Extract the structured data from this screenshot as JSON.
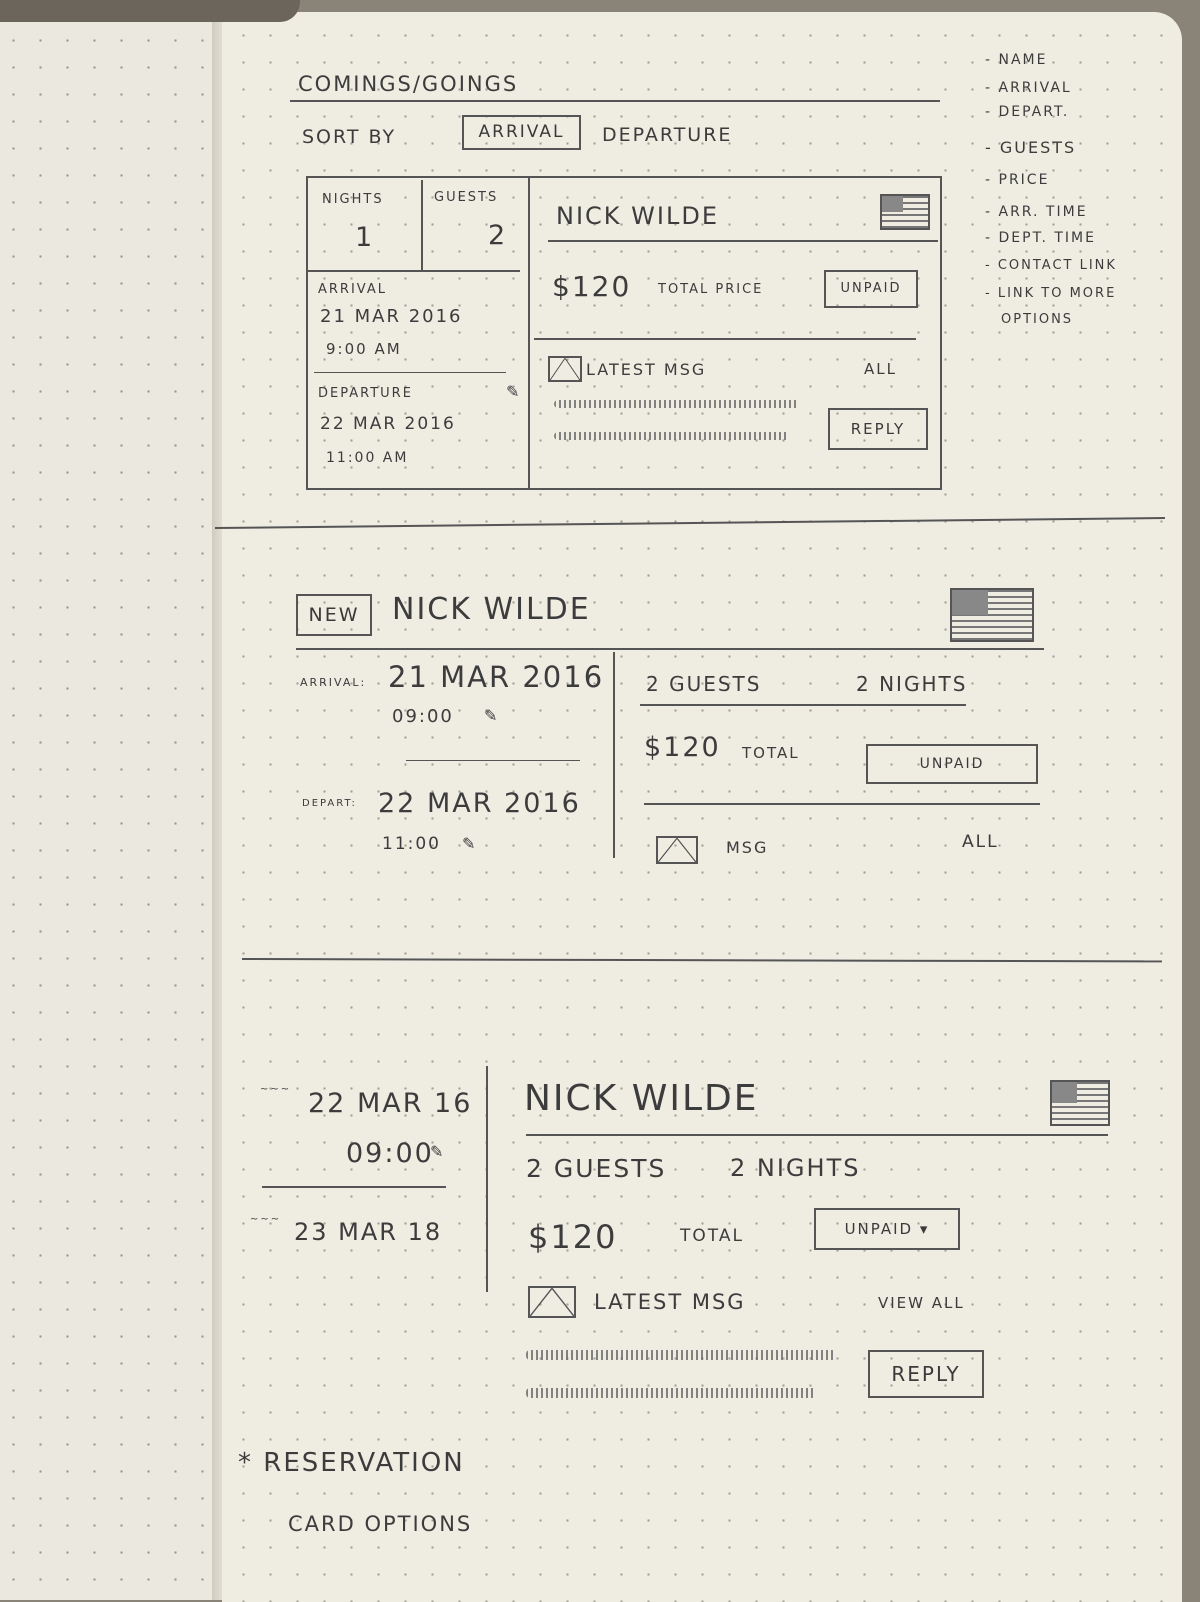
{
  "page_title": "COMINGS/GOINGS",
  "sort": {
    "label": "SORT BY",
    "arrival": "ARRIVAL",
    "departure": "DEPARTURE"
  },
  "side_notes": [
    "- NAME",
    "- ARRIVAL",
    "- DEPART.",
    "- GUESTS",
    "- PRICE",
    "- ARR. TIME",
    "- DEPT. TIME",
    "- CONTACT LINK",
    "- LINK TO MORE",
    "OPTIONS"
  ],
  "card1": {
    "nights_label": "NIGHTS",
    "nights": "1",
    "guests_label": "GUESTS",
    "guests": "2",
    "arrival_label": "ARRIVAL",
    "arrival_date": "21 MAR 2016",
    "arrival_time": "9:00 AM",
    "departure_label": "DEPARTURE",
    "departure_date": "22 MAR 2016",
    "departure_time": "11:00 AM",
    "name": "NICK WILDE",
    "price": "$120",
    "price_label": "TOTAL PRICE",
    "status": "UNPAID",
    "msg_label": "LATEST MSG",
    "all": "ALL",
    "reply": "REPLY"
  },
  "card2": {
    "badge": "NEW",
    "name": "NICK WILDE",
    "arrival_label": "ARRIVAL:",
    "arrival_date": "21 MAR 2016",
    "arrival_time": "09:00",
    "departure_label": "DEPART:",
    "departure_date": "22 MAR 2016",
    "departure_time": "11:00",
    "guests": "2 GUESTS",
    "nights": "2 NIGHTS",
    "price": "$120",
    "price_label": "TOTAL",
    "status": "UNPAID",
    "msg_label": "MSG",
    "all": "ALL"
  },
  "card3": {
    "arrival_date": "22 MAR 16",
    "arrival_time": "09:00",
    "departure_date": "23 MAR 18",
    "name": "NICK WILDE",
    "guests": "2 GUESTS",
    "nights": "2 NIGHTS",
    "price": "$120",
    "price_label": "TOTAL",
    "status": "UNPAID",
    "msg_label": "LATEST MSG",
    "view_all": "VIEW ALL",
    "reply": "REPLY"
  },
  "footnote": {
    "line1": "* RESERVATION",
    "line2": "CARD OPTIONS"
  }
}
